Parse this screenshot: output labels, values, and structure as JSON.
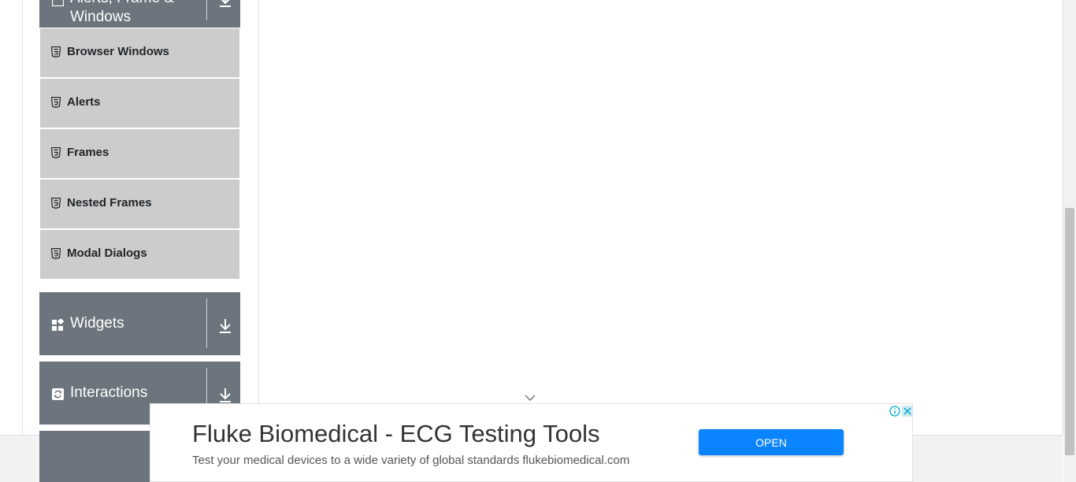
{
  "sidebar": {
    "group_top": {
      "label_line1": "Alerts, Frame &",
      "label_line2": "Windows",
      "icon": "window-icon",
      "toggle_icon": "download-arrow-icon"
    },
    "items": [
      {
        "label": "Browser Windows",
        "icon": "html5-icon"
      },
      {
        "label": "Alerts",
        "icon": "html5-icon"
      },
      {
        "label": "Frames",
        "icon": "html5-icon"
      },
      {
        "label": "Nested Frames",
        "icon": "html5-icon"
      },
      {
        "label": "Modal Dialogs",
        "icon": "html5-icon"
      }
    ],
    "groups": [
      {
        "label": "Widgets",
        "icon": "widgets-icon",
        "toggle_icon": "download-arrow-icon"
      },
      {
        "label": "Interactions",
        "icon": "interactions-icon",
        "toggle_icon": "download-arrow-icon"
      }
    ]
  },
  "ad": {
    "title": "Fluke Biomedical - ECG Testing Tools",
    "description": "Test your medical devices to a wide variety of global standards flukebiomedical.com",
    "open_label": "OPEN",
    "info_icon": "info-icon",
    "close_icon": "close-icon"
  },
  "colors": {
    "group_bg": "#6c757d",
    "item_bg": "#cccccc",
    "open_button": "#0a84ff"
  }
}
